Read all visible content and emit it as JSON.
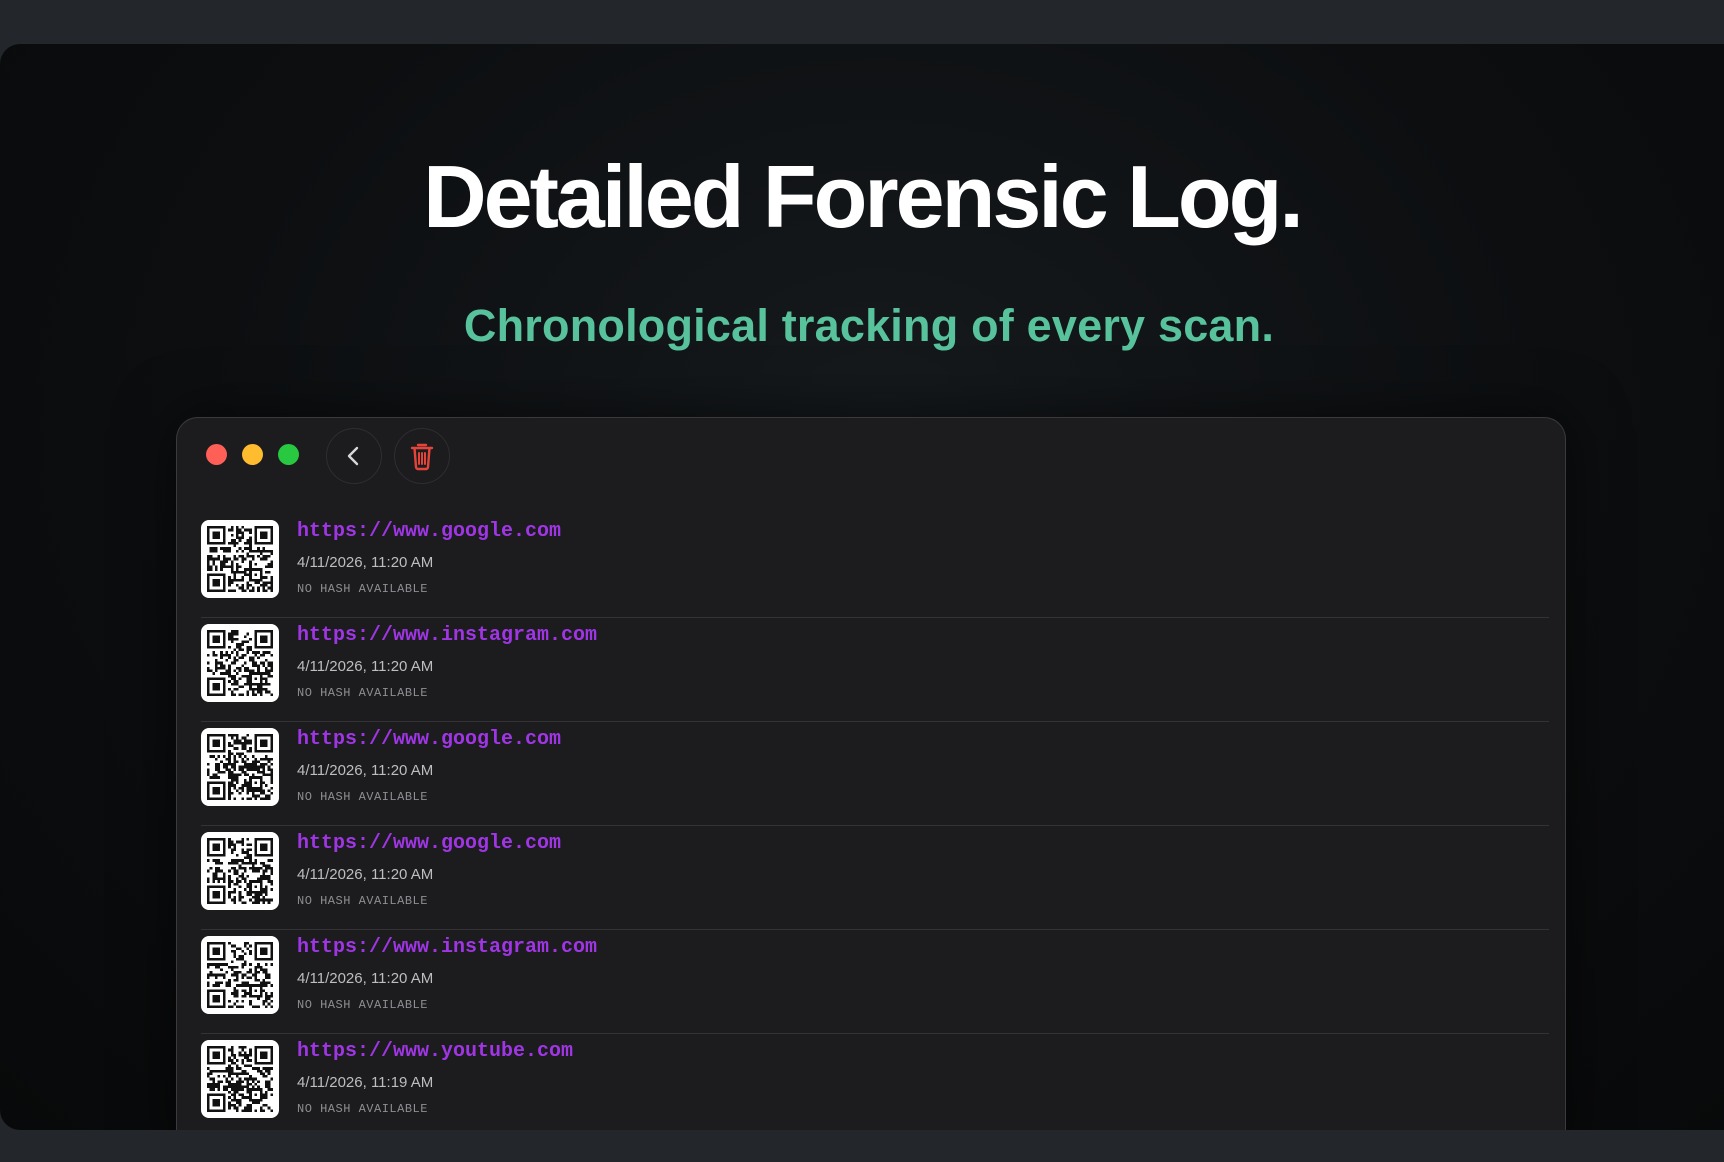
{
  "hero": {
    "title": "Detailed Forensic Log.",
    "subtitle": "Chronological tracking of every scan."
  },
  "window": {
    "toolbar": {
      "back_icon": "chevron-left-icon",
      "trash_icon": "trash-icon",
      "trash_color": "#e5443a"
    },
    "colors": {
      "url": "#a035e6",
      "accent_green": "#57c29b",
      "traffic_red": "#fe5f57",
      "traffic_yellow": "#febc2e",
      "traffic_green": "#28c840"
    },
    "entries": [
      {
        "url": "https://www.google.com",
        "timestamp": "4/11/2026, 11:20 AM",
        "hash": "NO HASH AVAILABLE"
      },
      {
        "url": "https://www.instagram.com",
        "timestamp": "4/11/2026, 11:20 AM",
        "hash": "NO HASH AVAILABLE"
      },
      {
        "url": "https://www.google.com",
        "timestamp": "4/11/2026, 11:20 AM",
        "hash": "NO HASH AVAILABLE"
      },
      {
        "url": "https://www.google.com",
        "timestamp": "4/11/2026, 11:20 AM",
        "hash": "NO HASH AVAILABLE"
      },
      {
        "url": "https://www.instagram.com",
        "timestamp": "4/11/2026, 11:20 AM",
        "hash": "NO HASH AVAILABLE"
      },
      {
        "url": "https://www.youtube.com",
        "timestamp": "4/11/2026, 11:19 AM",
        "hash": "NO HASH AVAILABLE"
      }
    ]
  }
}
